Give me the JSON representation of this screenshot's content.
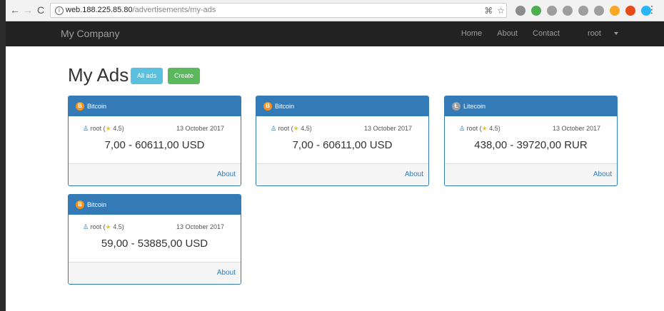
{
  "browser": {
    "url_host": "web.188.225.85.80",
    "url_path": "/advertisements/my-ads",
    "extension_colors": [
      "#8c8c8c",
      "#4caf50",
      "#9e9e9e",
      "#9e9e9e",
      "#9e9e9e",
      "#9e9e9e",
      "#f9a825",
      "#e64a19",
      "#29b6f6"
    ]
  },
  "navbar": {
    "brand": "My Company",
    "links": [
      "Home",
      "About",
      "Contact"
    ],
    "user_menu": "root"
  },
  "page": {
    "title": "My Ads",
    "all_ads_button": "All ads",
    "create_button": "Create"
  },
  "ads": [
    {
      "coin": "Bitcoin",
      "user": "root",
      "rating": "4.5",
      "date": "13 October 2017",
      "price": "7,00 - 60611,00 USD",
      "about": "About"
    },
    {
      "coin": "Bitcoin",
      "user": "root",
      "rating": "4.5",
      "date": "13 October 2017",
      "price": "7,00 - 60611,00 USD",
      "about": "About"
    },
    {
      "coin": "Litecoin",
      "user": "root",
      "rating": "4.5",
      "date": "13 October 2017",
      "price": "438,00 - 39720,00 RUR",
      "about": "About"
    },
    {
      "coin": "Bitcoin",
      "user": "root",
      "rating": "4.5",
      "date": "13 October 2017",
      "price": "59,00 - 53885,00 USD",
      "about": "About"
    }
  ],
  "colors": {
    "primary": "#337ab7",
    "info": "#5bc0de",
    "success": "#5cb85c",
    "navbar": "#222222",
    "bitcoin": "#f7931a"
  }
}
